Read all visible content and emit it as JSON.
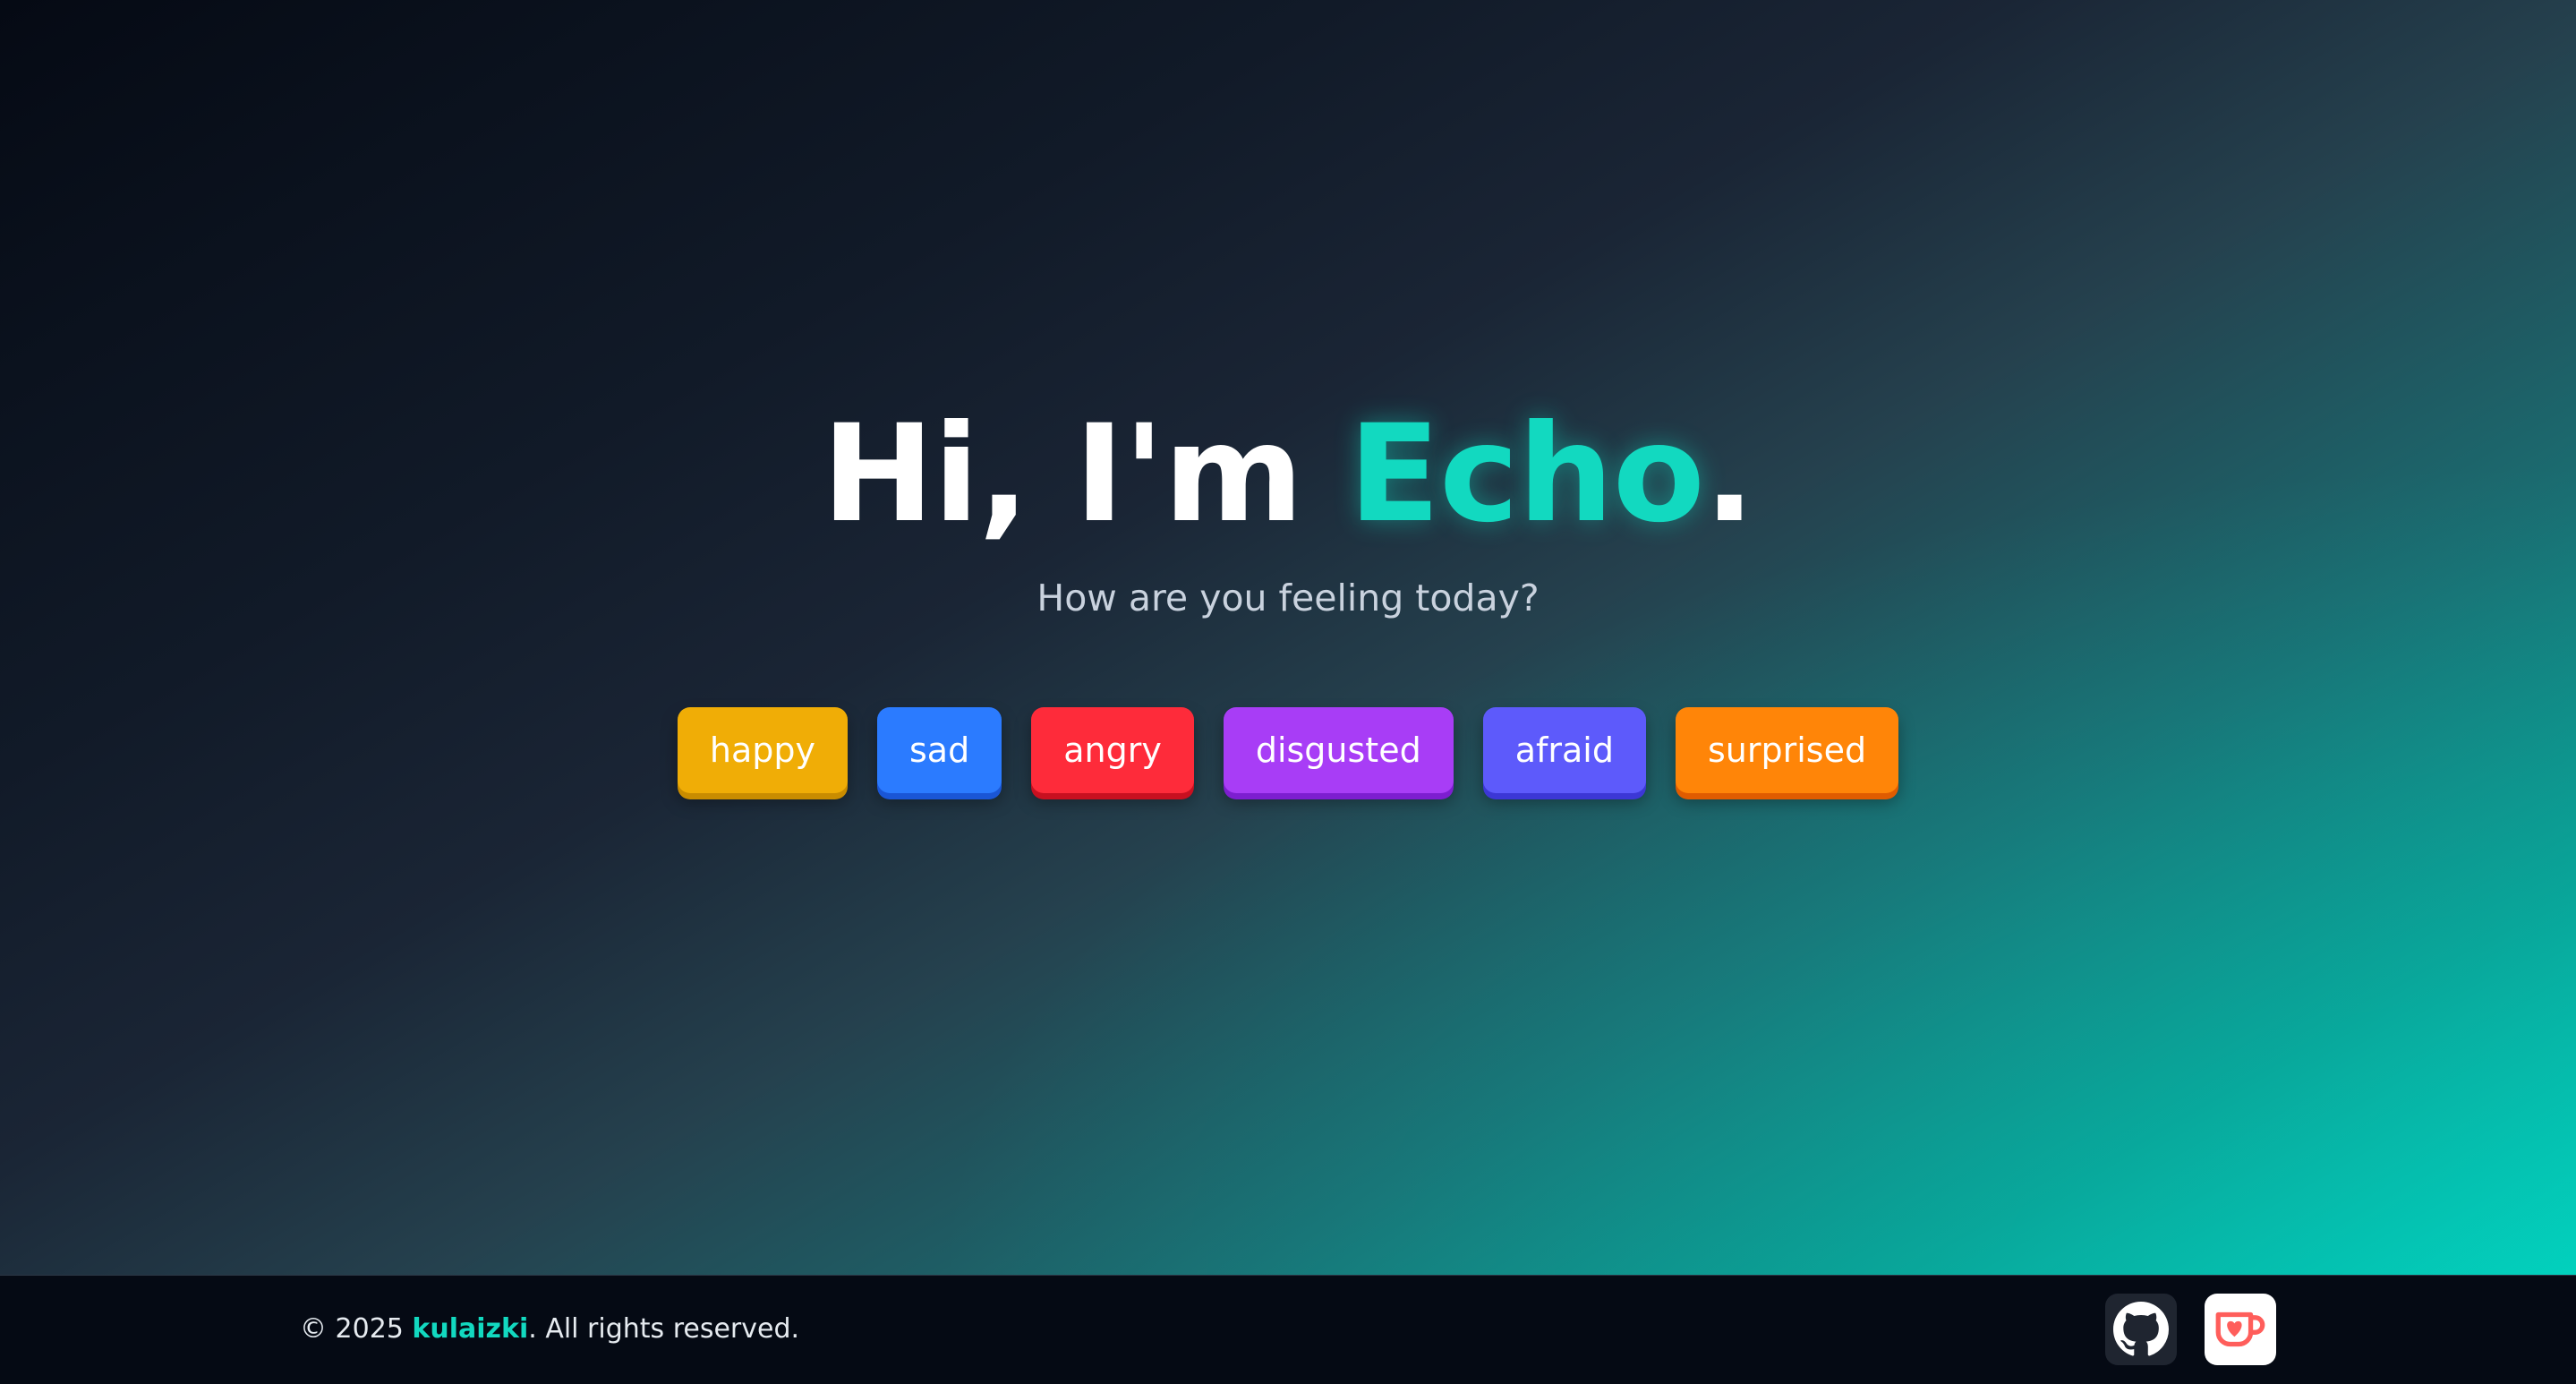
{
  "hero": {
    "greeting": "Hi, I'm ",
    "name": "Echo",
    "period": ".",
    "subtitle": "How are you feeling today?"
  },
  "moods": [
    {
      "label": "happy",
      "color": "#f0ad06",
      "shade": "#c98c00"
    },
    {
      "label": "sad",
      "color": "#2b7bff",
      "shade": "#1a56d6"
    },
    {
      "label": "angry",
      "color": "#fe2b3a",
      "shade": "#c81020"
    },
    {
      "label": "disgusted",
      "color": "#a83df6",
      "shade": "#7d1ed0"
    },
    {
      "label": "afraid",
      "color": "#5d5afb",
      "shade": "#3c37d6"
    },
    {
      "label": "surprised",
      "color": "#ff8508",
      "shade": "#e05c00"
    }
  ],
  "footer": {
    "copyright_prefix": "© 2025 ",
    "brand": "kulaizki",
    "copyright_suffix": ". All rights reserved.",
    "github_icon": "github-icon",
    "kofi_icon": "kofi-cup-icon"
  },
  "colors": {
    "accent": "#12d9c0",
    "footer_bg": "#050a14"
  }
}
